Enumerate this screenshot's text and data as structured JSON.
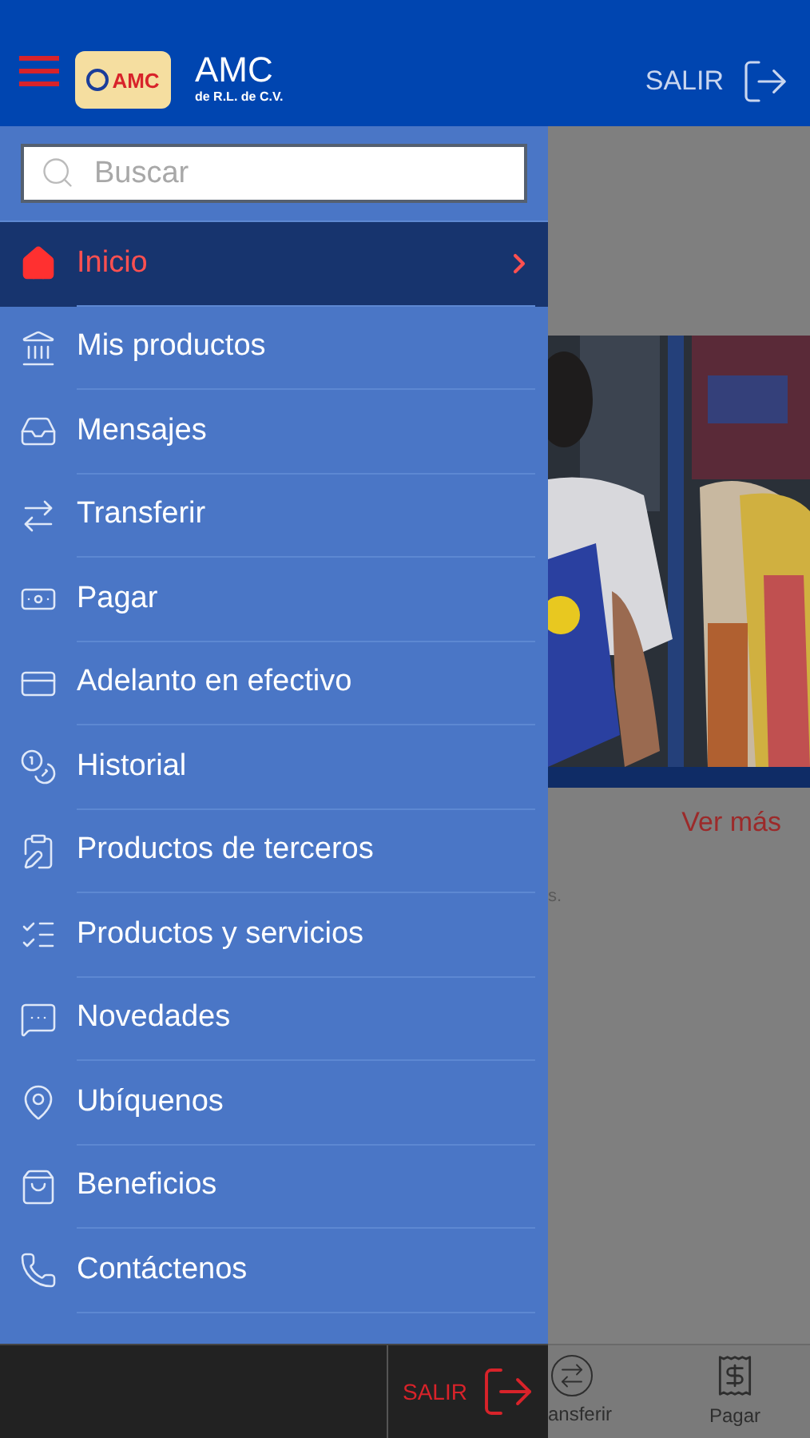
{
  "header": {
    "logo_text": "AMC",
    "brand_title": "AMC",
    "brand_subtitle": "de R.L. de C.V.",
    "logout": "SALIR"
  },
  "search": {
    "placeholder": "Buscar"
  },
  "menu": [
    {
      "label": "Inicio",
      "selected": true
    },
    {
      "label": "Mis productos",
      "selected": false
    },
    {
      "label": "Mensajes",
      "selected": false
    },
    {
      "label": "Transferir",
      "selected": false
    },
    {
      "label": "Pagar",
      "selected": false
    },
    {
      "label": "Adelanto en efectivo",
      "selected": false
    },
    {
      "label": "Historial",
      "selected": false
    },
    {
      "label": "Productos de terceros",
      "selected": false
    },
    {
      "label": "Productos y servicios",
      "selected": false
    },
    {
      "label": "Novedades",
      "selected": false
    },
    {
      "label": "Ubíquenos",
      "selected": false
    },
    {
      "label": "Beneficios",
      "selected": false
    },
    {
      "label": "Contáctenos",
      "selected": false
    }
  ],
  "content": {
    "link": "Ver más",
    "text_fragment": "s."
  },
  "drawer_footer": {
    "logout": "SALIR"
  },
  "tab_bar": [
    {
      "label": "ansferir"
    },
    {
      "label": "Pagar"
    }
  ]
}
